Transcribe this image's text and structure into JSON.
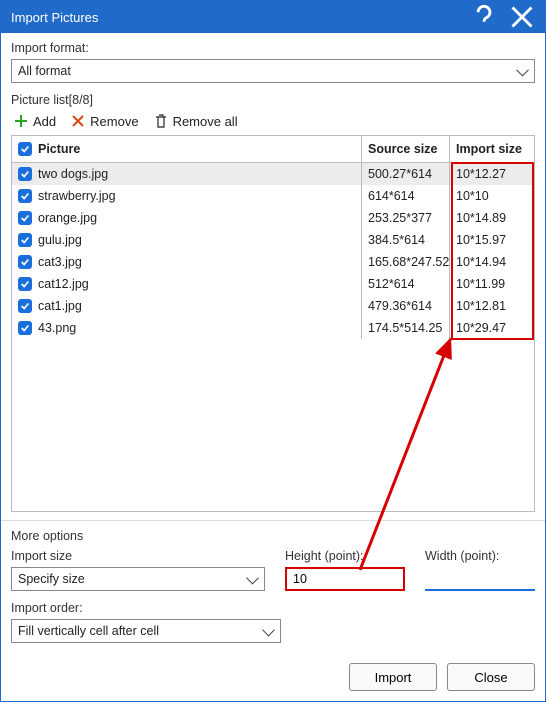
{
  "title": "Import Pictures",
  "format_label": "Import format:",
  "format_value": "All format",
  "piclist_label": "Picture list[8/8]",
  "toolbar": {
    "add": "Add",
    "remove": "Remove",
    "remove_all": "Remove all"
  },
  "columns": {
    "picture": "Picture",
    "source": "Source size",
    "import": "Import size"
  },
  "rows": [
    {
      "name": "two dogs.jpg",
      "src": "500.27*614",
      "imp": "10*12.27",
      "selected": true
    },
    {
      "name": "strawberry.jpg",
      "src": "614*614",
      "imp": "10*10"
    },
    {
      "name": "orange.jpg",
      "src": "253.25*377",
      "imp": "10*14.89"
    },
    {
      "name": "gulu.jpg",
      "src": "384.5*614",
      "imp": "10*15.97"
    },
    {
      "name": "cat3.jpg",
      "src": "165.68*247.52",
      "imp": "10*14.94"
    },
    {
      "name": "cat12.jpg",
      "src": "512*614",
      "imp": "10*11.99"
    },
    {
      "name": "cat1.jpg",
      "src": "479.36*614",
      "imp": "10*12.81"
    },
    {
      "name": "43.png",
      "src": "174.5*514.25",
      "imp": "10*29.47"
    }
  ],
  "more_label": "More options",
  "import_size_label": "Import size",
  "import_size_value": "Specify size",
  "height_label": "Height (point):",
  "height_value": "10",
  "width_label": "Width (point):",
  "width_value": "",
  "import_order_label": "Import order:",
  "import_order_value": "Fill vertically cell after cell",
  "buttons": {
    "import": "Import",
    "close": "Close"
  }
}
